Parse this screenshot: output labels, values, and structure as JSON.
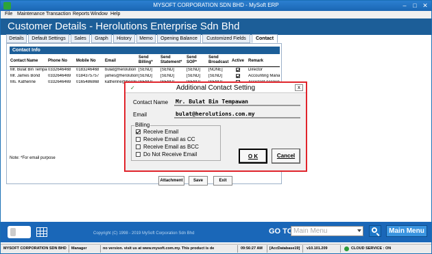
{
  "window": {
    "title": "MYSOFT CORPORATION SDN BHD - MySoft ERP",
    "minimize": "–",
    "maximize": "□",
    "close": "✕"
  },
  "menu": [
    "File",
    "Maintenance",
    "Transaction",
    "Reports",
    "Window",
    "Help"
  ],
  "page_title": "Customer Details - Herolutions Enterprise Sdn Bhd",
  "tabs": [
    "Details",
    "Default Settings",
    "Sales",
    "Graph",
    "History",
    "Memo",
    "Opening Balance",
    "Customized Fields",
    "Contact"
  ],
  "contact": {
    "section_title": "Contact Info",
    "columns": [
      "Contact Name",
      "Phone No",
      "Mobile No",
      "Email",
      "Send Billing*",
      "Send Statement*",
      "Send SOP*",
      "Send Broadcast",
      "Active",
      "Remark"
    ],
    "rows": [
      {
        "name": "Mr. Bulat Bin Tempa",
        "phone": "0332646468",
        "mobile": "0183246468",
        "email": "bulat@herolution",
        "billing": "[SEND]",
        "statement": "[SEND]",
        "sop": "[SEND]",
        "broadcast": "[NONE]",
        "active": true,
        "remark": "Director"
      },
      {
        "name": "Mr. James Bond",
        "phone": "0332646469",
        "mobile": "0184375757",
        "email": "james@herolution",
        "billing": "[SEND]",
        "statement": "[SEND]",
        "sop": "[SEND]",
        "broadcast": "[SEND]",
        "active": true,
        "remark": "Accounting Mana"
      },
      {
        "name": "Ms. Katherine",
        "phone": "0332646469",
        "mobile": "0165486868",
        "email": "katherine@herolu",
        "billing": "[SEND]",
        "statement": "[SEND]",
        "sop": "[SEND]",
        "broadcast": "[SEND]",
        "active": true,
        "remark": "Assistant Accoun"
      }
    ],
    "note": "Note: *For email purpose"
  },
  "actions": {
    "attachment": "Attachment",
    "save": "Save",
    "exit": "Exit"
  },
  "dialog": {
    "title": "Additional Contact Setting",
    "close": "x",
    "contact_name_label": "Contact Name",
    "contact_name_value": "Mr. Bulat Bin Tempawan",
    "email_label": "Email",
    "email_value": "bulat@herolutions.com.my",
    "billing_title": "Billing",
    "options": [
      {
        "label": "Receive Email",
        "checked": true
      },
      {
        "label": "Receive Email as CC",
        "checked": false
      },
      {
        "label": "Receive Email as BCC",
        "checked": false
      },
      {
        "label": "Do Not Receive Email",
        "checked": false
      }
    ],
    "ok": "O K",
    "cancel": "Cancel"
  },
  "footer": {
    "copyright": "Copyright (C) 1998 - 2019 MySoft Corporation Sdn Bhd",
    "goto_label": "GO TO",
    "goto_placeholder": "Main Menu",
    "main_menu": "Main Menu"
  },
  "status": {
    "company": "MYSOFT CORPORATION SDN BHD",
    "user": "Manager",
    "message": "no version. visit us at www.mysoft.com.my. This product is de",
    "time": "09:56:27 AM",
    "database": "[AccDatabase19]",
    "version": "v10.101.209",
    "cloud": "CLOUD SERVICE : ON"
  },
  "colors": {
    "header": "#1c5e98",
    "footer": "#1a67b8",
    "dialog_border": "#e0232a"
  }
}
